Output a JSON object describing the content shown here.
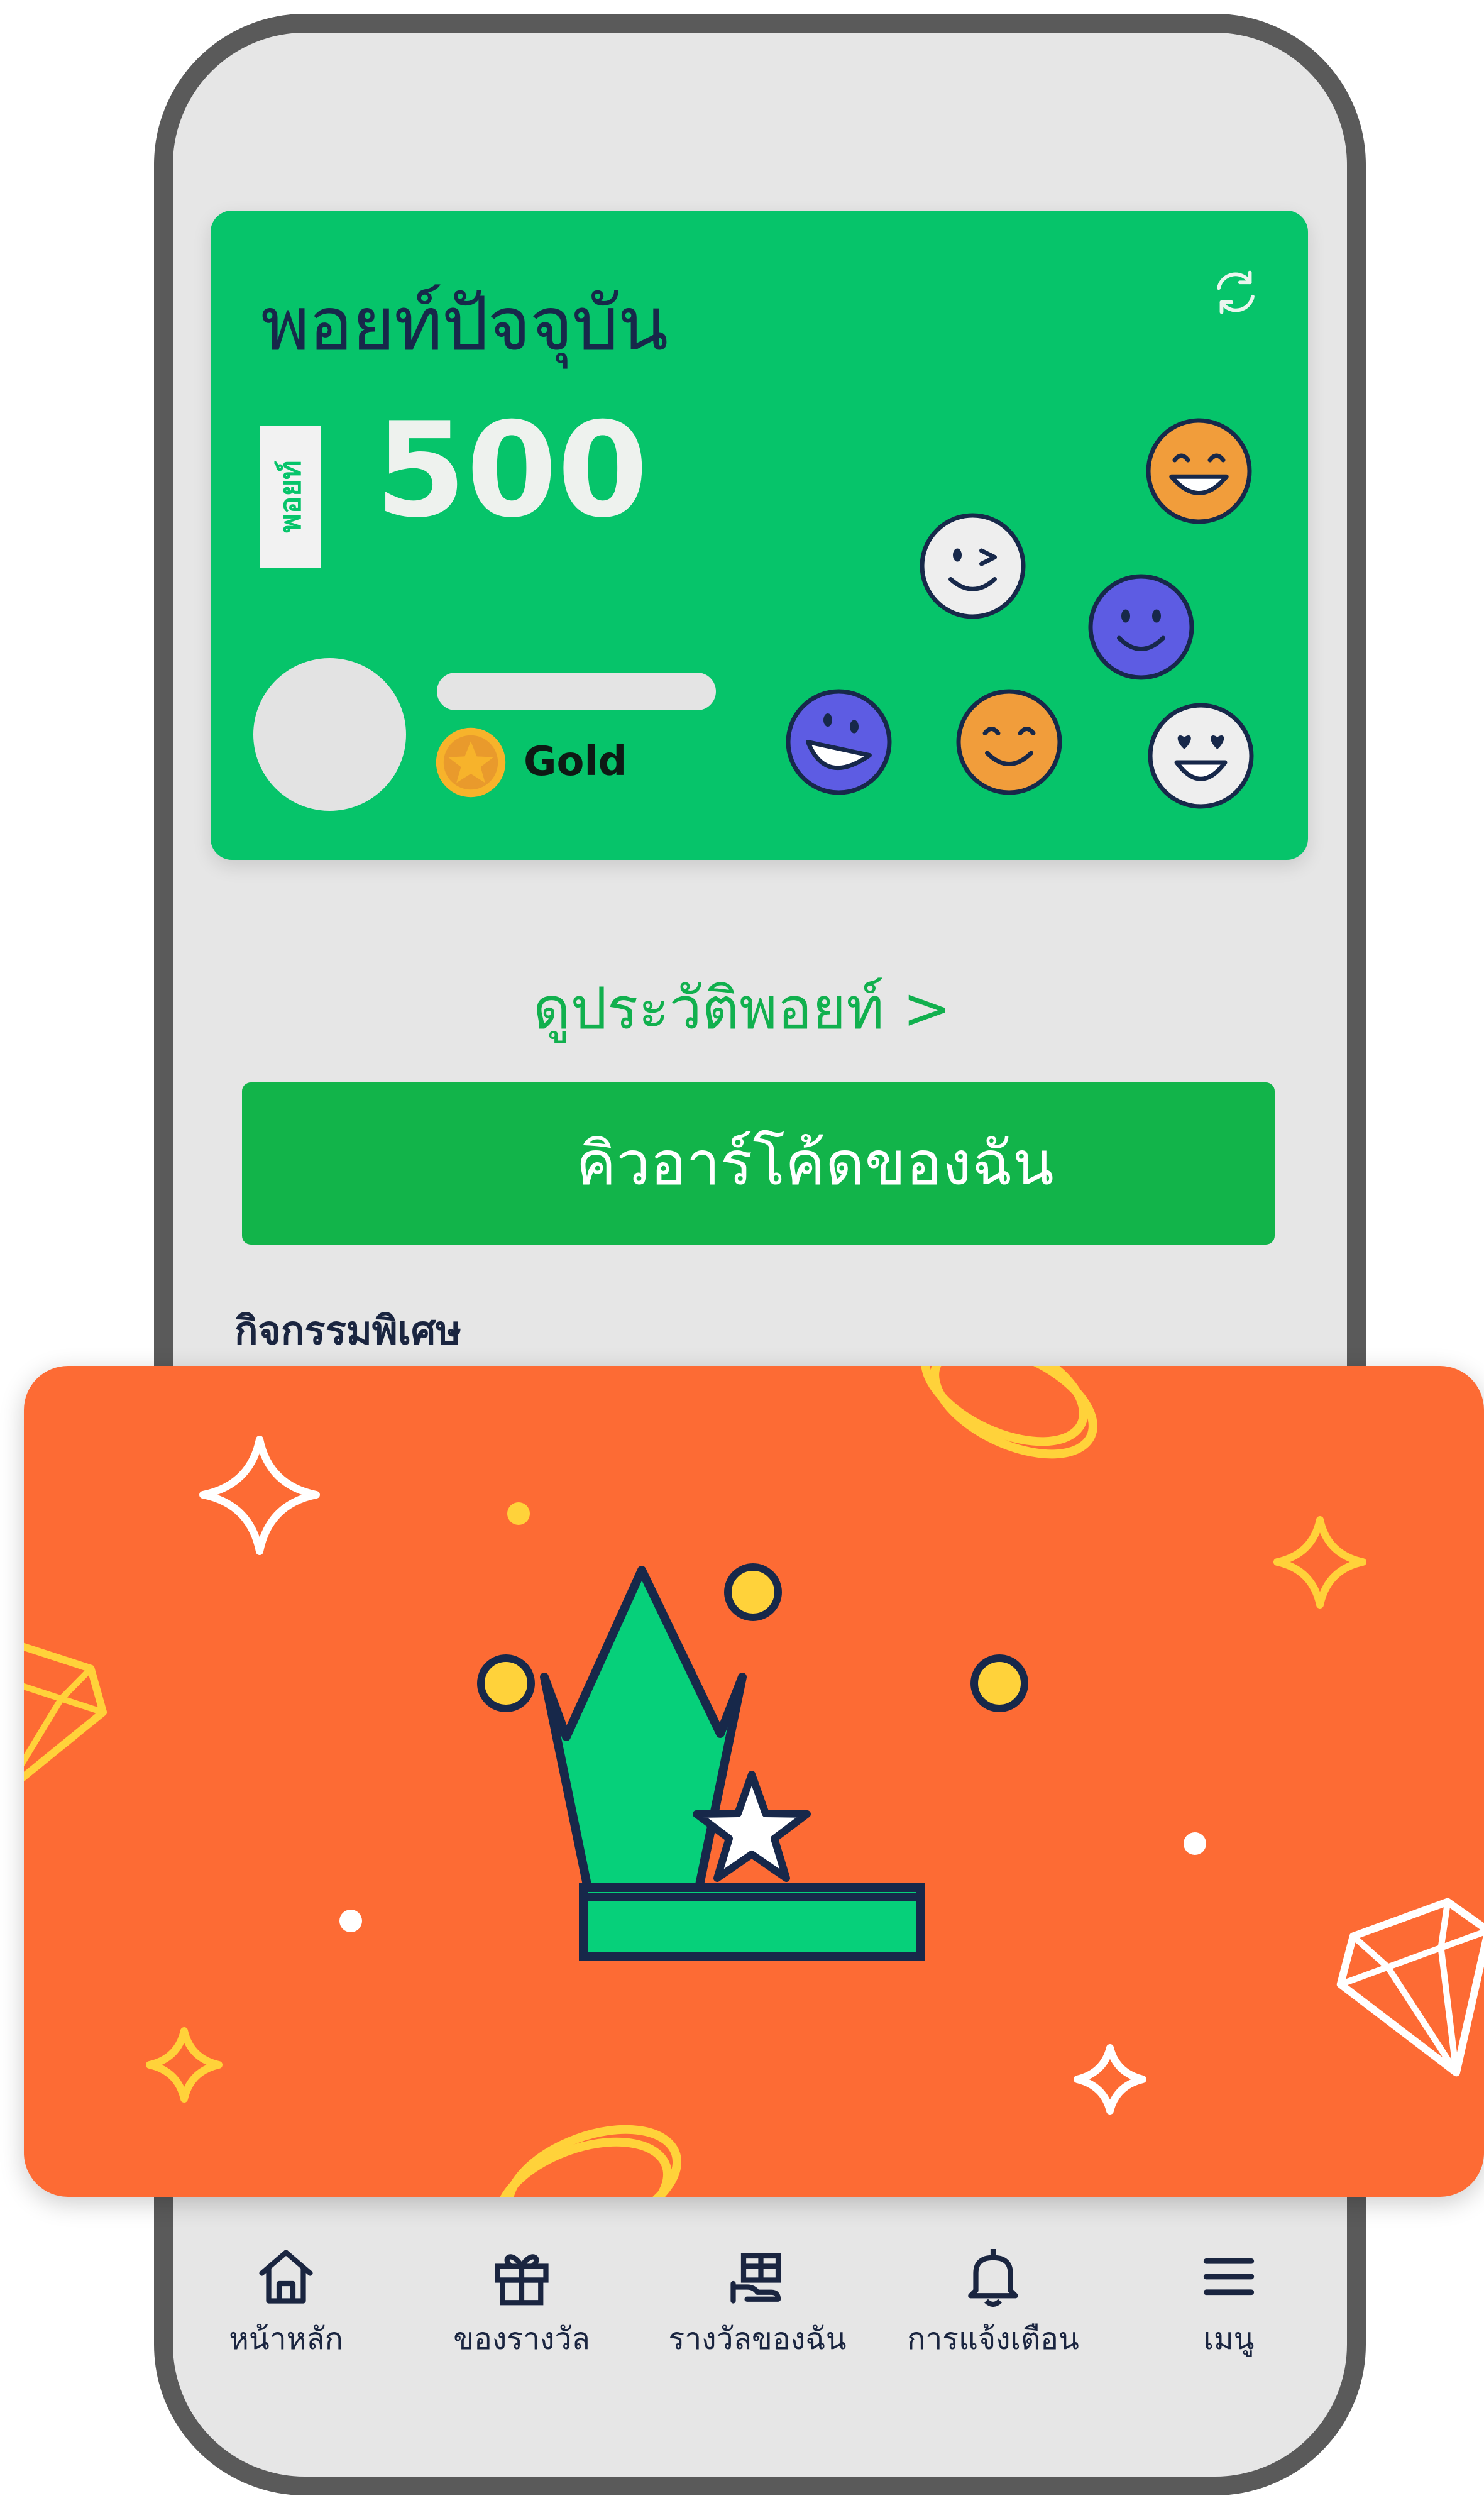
{
  "points_card": {
    "title": "พอยท์ปัจจุบัน",
    "badge": "พอยท์",
    "value": "500",
    "tier": "Gold"
  },
  "history_link": "ดูประวัติพอยท์ >",
  "qr_button": "คิวอาร์โค้ดของฉัน",
  "section_title": "กิจกรรมพิเศษ",
  "bottom_nav": [
    {
      "label": "หน้าหลัก",
      "icon": "home-icon"
    },
    {
      "label": "ของรางวัล",
      "icon": "gift-icon"
    },
    {
      "label": "รางวัลของฉัน",
      "icon": "reward-hand-icon"
    },
    {
      "label": "การแจ้งเตือน",
      "icon": "bell-icon"
    },
    {
      "label": "เมนู",
      "icon": "menu-icon"
    }
  ],
  "colors": {
    "brand_green": "#06c46a",
    "button_green": "#12b44a",
    "banner_orange": "#fd6b34"
  }
}
